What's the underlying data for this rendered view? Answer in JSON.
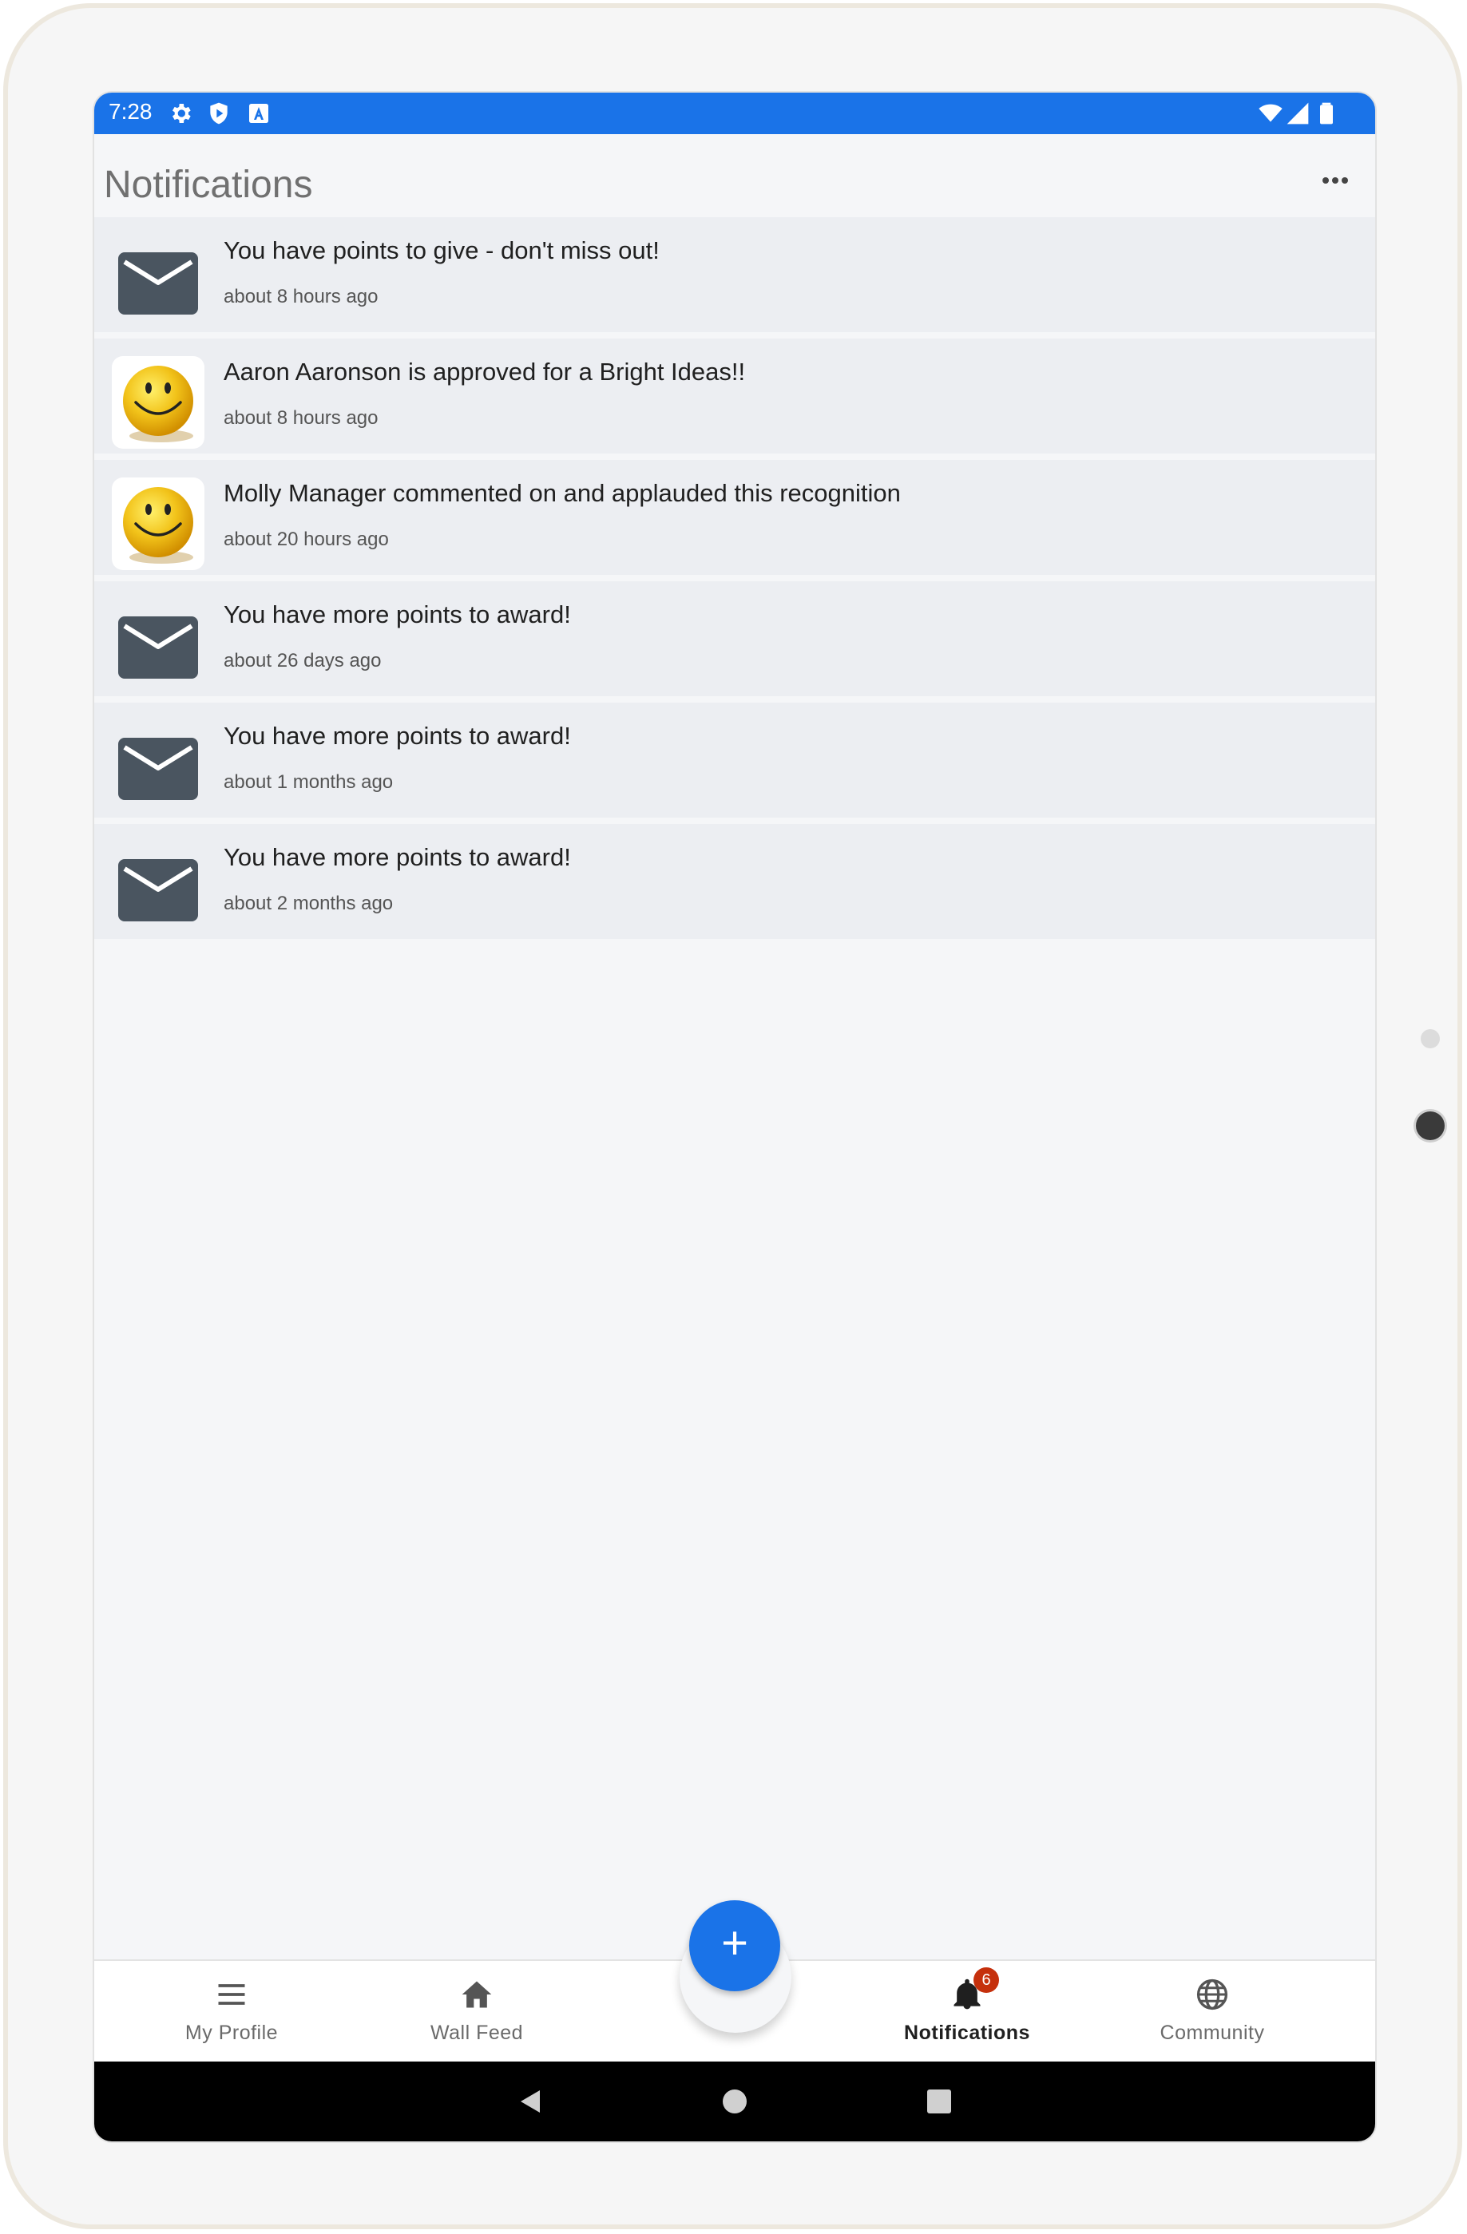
{
  "status_bar": {
    "time": "7:28",
    "left_icons": [
      "gear-icon",
      "shield-play-icon",
      "a-badge-icon"
    ],
    "right_icons": [
      "wifi-icon",
      "signal-icon",
      "battery-icon"
    ],
    "color": "#1a73e8"
  },
  "header": {
    "title": "Notifications",
    "more_icon": "more-horizontal-icon"
  },
  "notifications": [
    {
      "avatar": "mail-icon",
      "title": "You have points to give - don't miss out!",
      "time": "about 8 hours ago"
    },
    {
      "avatar": "smiley-avatar",
      "title": "Aaron Aaronson is approved for a Bright Ideas!!",
      "time": "about 8 hours ago"
    },
    {
      "avatar": "smiley-avatar",
      "title": "Molly Manager commented on and applauded this recognition",
      "time": "about 20 hours ago"
    },
    {
      "avatar": "mail-icon",
      "title": "You have more points to award!",
      "time": "about 26 days ago"
    },
    {
      "avatar": "mail-icon",
      "title": "You have more points to award!",
      "time": "about 1 months ago"
    },
    {
      "avatar": "mail-icon",
      "title": "You have more points to award!",
      "time": "about 2 months ago"
    }
  ],
  "fab": {
    "label": "+",
    "color": "#1a73e8"
  },
  "bottom_nav": {
    "items": [
      {
        "label": "My Profile",
        "icon": "menu-icon"
      },
      {
        "label": "Wall Feed",
        "icon": "home-icon"
      },
      {
        "label": "Notifications",
        "icon": "bell-icon",
        "badge": "6",
        "active": true
      },
      {
        "label": "Community",
        "icon": "globe-icon"
      }
    ],
    "badge_color": "#c5300c"
  },
  "system_nav": [
    "back-icon",
    "home-circle-icon",
    "recents-icon"
  ]
}
